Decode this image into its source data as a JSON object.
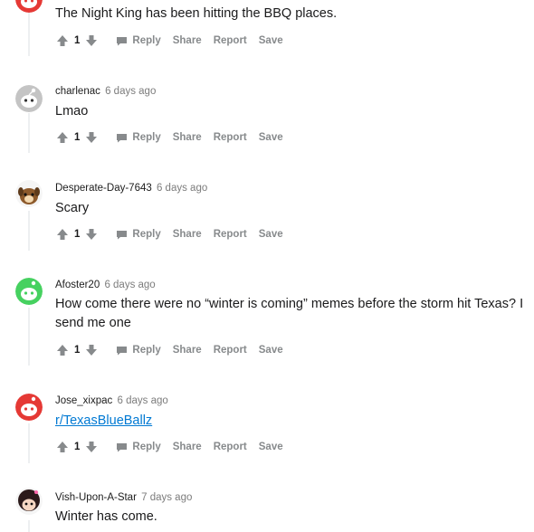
{
  "actions": {
    "reply": "Reply",
    "share": "Share",
    "report": "Report",
    "save": "Save"
  },
  "comments": [
    {
      "username": "",
      "time": "",
      "body": "The Night King has been hitting the BBQ places.",
      "votes": "1",
      "avatar": "red-snoo-icon"
    },
    {
      "username": "charlenac",
      "time": "6 days ago",
      "body": "Lmao",
      "votes": "1",
      "avatar": "gray-snoo-icon"
    },
    {
      "username": "Desperate-Day-7643",
      "time": "6 days ago",
      "body": "Scary",
      "votes": "1",
      "avatar": "dog-snoo-icon"
    },
    {
      "username": "Afoster20",
      "time": "6 days ago",
      "body": "How come there were no “winter is coming” memes before the storm hit Texas? I send me one",
      "votes": "1",
      "avatar": "green-snoo-icon"
    },
    {
      "username": "Jose_xixpac",
      "time": "6 days ago",
      "body": "r/TexasBlueBallz",
      "votes": "1",
      "avatar": "red-snoo-icon"
    },
    {
      "username": "Vish-Upon-A-Star",
      "time": "7 days ago",
      "body": "Winter has come.",
      "votes": "",
      "avatar": "dark-hair-snoo-icon"
    }
  ]
}
